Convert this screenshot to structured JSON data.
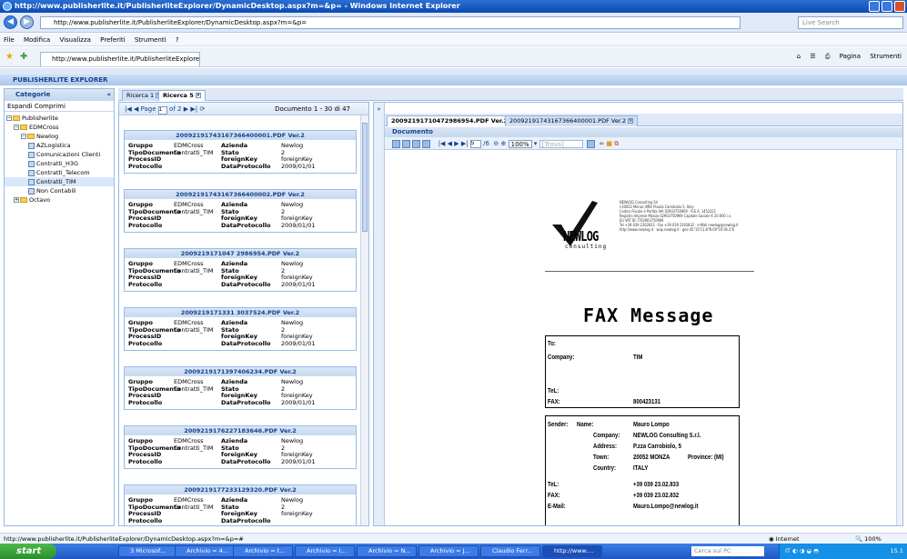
{
  "window": {
    "title": "http://www.publisherlite.it/PublisherliteExplorer/DynamicDesktop.aspx?m=&p= - Windows Internet Explorer"
  },
  "addressbar": {
    "url": "http://www.publisherlite.it/PublisherliteExplorer/DynamicDesktop.aspx?m=&p=",
    "search_placeholder": "Live Search"
  },
  "menubar": {
    "items": [
      "File",
      "Modifica",
      "Visualizza",
      "Preferiti",
      "Strumenti",
      "?"
    ]
  },
  "favbar": {
    "tab_label": "http://www.publisherlite.it/PublisherliteExplorer/Dyna...",
    "pagina": "Pagina",
    "strumenti": "Strumenti"
  },
  "app": {
    "title": "PUBLISHERLITE EXPLORER"
  },
  "left": {
    "title": "Categorie",
    "expand": "Espandi",
    "collapse": "Comprimi",
    "tree": [
      {
        "label": "Publisherlite",
        "level": 0,
        "type": "folder",
        "sel": false
      },
      {
        "label": "EDMCross",
        "level": 1,
        "type": "folder",
        "sel": false
      },
      {
        "label": "Newlog",
        "level": 2,
        "type": "folder",
        "sel": false
      },
      {
        "label": "AZLogistica",
        "level": 3,
        "type": "doc",
        "sel": false
      },
      {
        "label": "Comunicazioni Clienti",
        "level": 3,
        "type": "doc",
        "sel": false
      },
      {
        "label": "Contratti_H3G",
        "level": 3,
        "type": "doc",
        "sel": false
      },
      {
        "label": "Contratti_Telecom",
        "level": 3,
        "type": "doc",
        "sel": false
      },
      {
        "label": "Contratti_TIM",
        "level": 3,
        "type": "doc",
        "sel": true
      },
      {
        "label": "Non Contabili",
        "level": 3,
        "type": "doc",
        "sel": false
      },
      {
        "label": "Octavo",
        "level": 1,
        "type": "folder",
        "sel": false
      }
    ]
  },
  "tabs": {
    "t1": "Ricerca 1",
    "t2": "Ricerca 5"
  },
  "paging": {
    "page_label": "Page",
    "page_value": "1",
    "of": "of 2",
    "summary": "Documento 1 - 30 di 47"
  },
  "cards": [
    {
      "title": "20092191743167366400001.PDF Ver.2",
      "gruppo": "EDMCross",
      "tipo": "Contratti_TIM",
      "azienda": "Newlog",
      "stato": "2",
      "processid": "",
      "fk": "foreignKey",
      "protocollo": "",
      "data": "2009/01/01"
    },
    {
      "title": "20092191743167366400002.PDF Ver.2",
      "gruppo": "EDMCross",
      "tipo": "Contratti_TIM",
      "azienda": "Newlog",
      "stato": "2",
      "processid": "",
      "fk": "foreignKey",
      "protocollo": "",
      "data": "2009/01/01"
    },
    {
      "title": "2009219171047 2986954.PDF Ver.2",
      "gruppo": "EDMCross",
      "tipo": "Contratti_TIM",
      "azienda": "Newlog",
      "stato": "2",
      "processid": "",
      "fk": "foreignKey",
      "protocollo": "",
      "data": "2009/01/01"
    },
    {
      "title": "2009219171331 3037524.PDF Ver.2",
      "gruppo": "EDMCross",
      "tipo": "Contratti_TIM",
      "azienda": "Newlog",
      "stato": "2",
      "processid": "",
      "fk": "foreignKey",
      "protocollo": "",
      "data": "2009/01/01"
    },
    {
      "title": "2009219171397406234.PDF Ver.2",
      "gruppo": "EDMCross",
      "tipo": "Contratti_TIM",
      "azienda": "Newlog",
      "stato": "2",
      "processid": "",
      "fk": "foreignKey",
      "protocollo": "",
      "data": "2009/01/01"
    },
    {
      "title": "2009219176227183646.PDF Ver.2",
      "gruppo": "EDMCross",
      "tipo": "Contratti_TIM",
      "azienda": "Newlog",
      "stato": "2",
      "processid": "",
      "fk": "foreignKey",
      "protocollo": "",
      "data": "2009/01/01"
    },
    {
      "title": "2009219177233129320.PDF Ver.2",
      "gruppo": "EDMCross",
      "tipo": "Contratti_TIM",
      "azienda": "Newlog",
      "stato": "2",
      "processid": "",
      "fk": "foreignKey",
      "protocollo": "",
      "data": ""
    }
  ],
  "labels": {
    "gruppo": "Gruppo",
    "tipo": "TipoDocumento",
    "processid": "ProcessID",
    "protocollo": "Protocollo",
    "azienda": "Azienda",
    "stato": "Stato",
    "fk": "foreignKey",
    "data": "DataProtocollo"
  },
  "doc": {
    "tab1": "20092191710472986954.PDF Ver.2",
    "tab2": "20092191743167366400001.PDF Ver.2",
    "header": "Documento",
    "page_value": "5",
    "page_of": "/6",
    "zoom": "100%",
    "find_placeholder": "[Trova]",
    "logo_text": "NEWLOG",
    "logo_sub": "consulting",
    "company_lines": [
      "NEWLOG Consulting Srl",
      "I-20052 Monza (MB) Piazza Carrobiolo 5, Italy",
      "Codice Fiscale e Partita IVA 02903750969 - R.E.A. 1452321",
      "Registro Imprese Monza 02903750969 Capitale Sociale € 20.000 i.v.",
      "EU VAT ID: IT02903750969",
      "Tel +39 039 2302833 · Fax +39 039 2302832 · e-Mail newlog@newlog.it",
      "http://www.newlog.it · wap.newlog.it · geo 45°35'11.8\"N 09°16'36.3\"E"
    ],
    "fax_title": "FAX Message",
    "to": "To:",
    "company": "Company:",
    "company_val": "TIM",
    "tel": "TeL:",
    "fax": "FAX:",
    "fax_val": "800423131",
    "sender": "Sender:",
    "name": "Name:",
    "name_val": "Mauro Lompo",
    "s_company": "Company:",
    "s_company_val": "NEWLOG Consulting S.r.l.",
    "address": "Address:",
    "address_val": "P.zza Carrobiolo, 5",
    "town": "Town:",
    "town_val": "20052 MONZA",
    "province": "Province: (MI)",
    "country": "Country:",
    "country_val": "ITALY",
    "s_tel": "TeL:",
    "s_tel_val": "+39 039 23.02.833",
    "s_fax": "FAX:",
    "s_fax_val": "+39 039 23.02.832",
    "email": "E-Mail:",
    "email_val": "Mauro.Lompo@newlog.it"
  },
  "status": {
    "url": "http://www.publisherlite.it/PublisherliteExplorer/DynamicDesktop.aspx?m=&p=#",
    "zone": "Internet",
    "zoom": "100%"
  },
  "taskbar": {
    "start": "start",
    "tasks": [
      "3 Microsof...",
      "Archivio = 4...",
      "Archivio = t...",
      "Archivio = I...",
      "Archivio = N...",
      "Archivio = J...",
      "Claudio Ferr...",
      "http://www...."
    ],
    "search_placeholder": "Cerca sul PC",
    "clock": "15.1"
  }
}
